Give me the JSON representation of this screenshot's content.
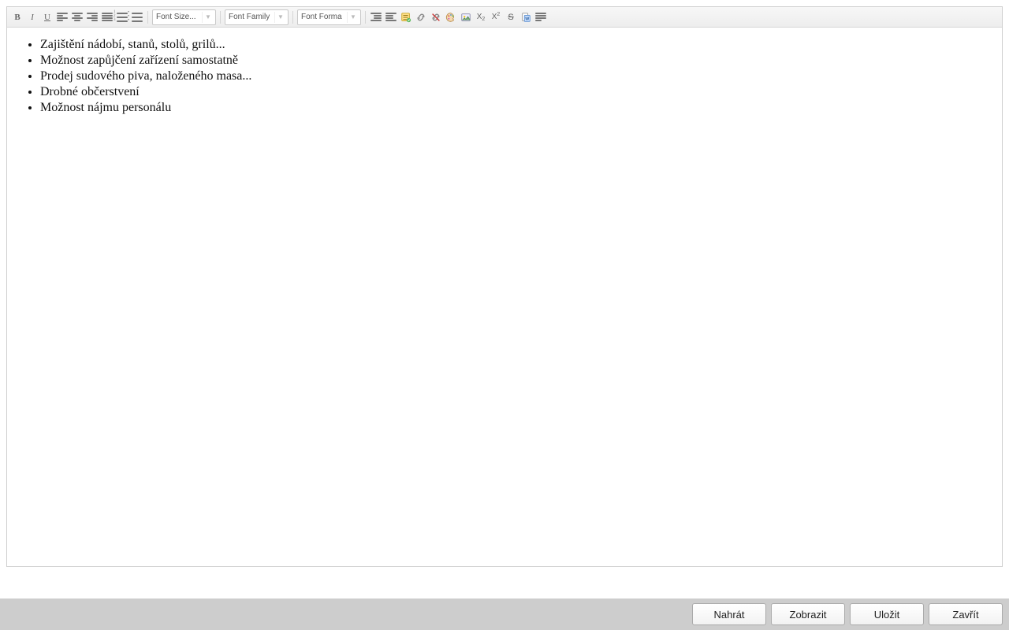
{
  "toolbar": {
    "bold_label": "B",
    "italic_label": "I",
    "underline_label": "U",
    "font_size_label": "Font Size...",
    "font_family_label": "Font Family",
    "font_format_label": "Font Forma",
    "sub_label": "X",
    "sub_sub": "2",
    "sup_label": "X",
    "sup_sup": "2",
    "strike_label": "S"
  },
  "content": {
    "items": [
      "Zajištění nádobí, stanů, stolů, grilů...",
      "Možnost zapůjčení zařízení samostatně",
      "Prodej sudového piva, naloženého masa...",
      "Drobné občerstvení",
      "Možnost nájmu personálu"
    ]
  },
  "footer": {
    "upload_label": "Nahrát",
    "show_label": "Zobrazit",
    "save_label": "Uložit",
    "close_label": "Zavřít"
  }
}
